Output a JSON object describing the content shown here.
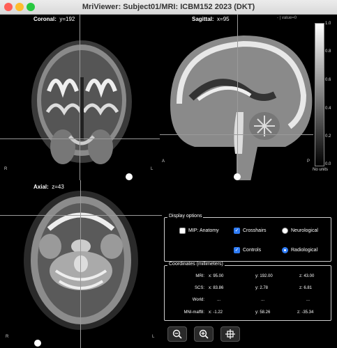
{
  "window": {
    "title": "MriViewer: Subject01/MRI: ICBM152 2023 (DKT)"
  },
  "views": {
    "coronal": {
      "name": "Coronal:",
      "coord": "y=192",
      "left": "R",
      "right": "L"
    },
    "sagittal": {
      "name": "Sagittal:",
      "coord": "x=95",
      "value": "- | value=0",
      "left": "A",
      "right": "P"
    },
    "axial": {
      "name": "Axial:",
      "coord": "z=43",
      "left": "R",
      "right": "L"
    }
  },
  "colorbar": {
    "ticks": [
      "1.0",
      "0.8",
      "0.6",
      "0.4",
      "0.2",
      "0.0"
    ],
    "units": "No units"
  },
  "display_options": {
    "title": "Display options",
    "mip": {
      "label": "MIP: Anatomy",
      "checked": false
    },
    "crosshairs": {
      "label": "Crosshairs",
      "checked": true
    },
    "controls": {
      "label": "Controls",
      "checked": true
    },
    "neurological": {
      "label": "Neurological",
      "selected": false
    },
    "radiological": {
      "label": "Radiological",
      "selected": true
    }
  },
  "coordinates": {
    "title": "Coordinates (millimeters)",
    "rows": [
      {
        "label": "MRI:",
        "x": "x: 95.00",
        "y": "y: 192.00",
        "z": "z: 43.00"
      },
      {
        "label": "SCS:",
        "x": "x: 83.86",
        "y": "y: 2.78",
        "z": "z: 6.81"
      },
      {
        "label": "World:",
        "x": "...",
        "y": "...",
        "z": "..."
      },
      {
        "label": "MNI-maff8:",
        "x": "x: -1.22",
        "y": "y: 58.26",
        "z": "z: -35.34"
      }
    ]
  },
  "toolbar": {
    "buttons": [
      "zoom-out-icon",
      "zoom-in-icon",
      "recenter-icon"
    ]
  },
  "colors": {
    "accent": "#2f7cf6",
    "close": "#ff5f57",
    "minimize": "#febc2e",
    "maximize": "#28c840"
  }
}
